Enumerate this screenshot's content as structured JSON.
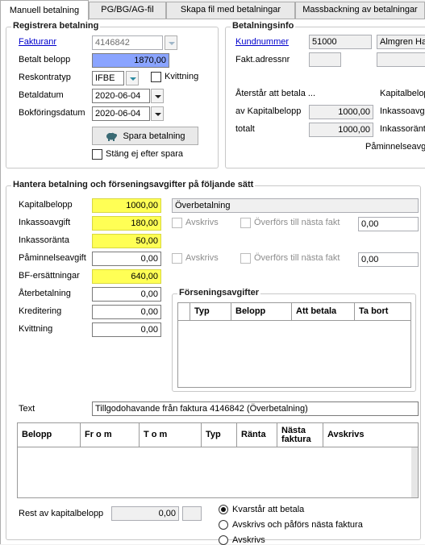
{
  "tabs": [
    "Manuell betalning",
    "PG/BG/AG-fil",
    "Skapa fil med betalningar",
    "Massbackning av betalningar"
  ],
  "register": {
    "title": "Registrera betalning",
    "fakturanr_label": "Fakturanr",
    "fakturanr_value": "4146842",
    "betalt_label": "Betalt belopp",
    "betalt_value": "1870,00",
    "reskontra_label": "Reskontratyp",
    "reskontra_value": "IFBE",
    "kvittning_label": "Kvittning",
    "betaldatum_label": "Betaldatum",
    "betaldatum_value": "2020-06-04",
    "bokforing_label": "Bokföringsdatum",
    "bokforing_value": "2020-06-04",
    "spara_label": "Spara betalning",
    "stang_label": "Stäng ej efter spara"
  },
  "info": {
    "title": "Betalningsinfo",
    "kundnummer_label": "Kundnummer",
    "kundnummer_value": "51000",
    "kundnamn_value": "Almgren Han",
    "fakt_label": "Fakt.adressnr",
    "aterstar_label": "Återstår att betala ...",
    "av_kap_label": "av Kapitalbelopp",
    "av_kap_value": "1000,00",
    "totalt_label": "totalt",
    "totalt_value": "1000,00",
    "right_labels": [
      "Kapitalbelop",
      "Inkassoavgi",
      "Inkassoränt",
      "Påminnelseavgi"
    ]
  },
  "hantera": {
    "title": "Hantera betalning och förseningsavgifter på följande sätt",
    "rows": [
      {
        "label": "Kapitalbelopp",
        "value": "1000,00"
      },
      {
        "label": "Inkassoavgift",
        "value": "180,00"
      },
      {
        "label": "Inkassoränta",
        "value": "50,00"
      },
      {
        "label": "Påminnelseavgift",
        "value": "0,00"
      },
      {
        "label": "BF-ersättningar",
        "value": "640,00"
      },
      {
        "label": "Återbetalning",
        "value": "0,00"
      },
      {
        "label": "Kreditering",
        "value": "0,00"
      },
      {
        "label": "Kvittning",
        "value": "0,00"
      }
    ],
    "status_value": "Överbetalning",
    "avskrivs_label": "Avskrivs",
    "overfors_label": "Överförs till nästa fakt",
    "overfors_value_1": "0,00",
    "overfors_value_2": "0,00",
    "forsenings": {
      "title": "Förseningsavgifter",
      "columns": [
        "Typ",
        "Belopp",
        "Att betala",
        "Ta bort"
      ]
    },
    "text_label": "Text",
    "text_value": "Tillgodohavande från faktura 4146842 (Överbetalning)"
  },
  "main_grid": {
    "columns": [
      "Belopp",
      "Fr o m",
      "T o m",
      "Typ",
      "Ränta",
      "Nästa faktura",
      "Avskrivs"
    ]
  },
  "rest": {
    "label": "Rest av kapitalbelopp",
    "value": "0,00",
    "options": [
      "Kvarstår att betala",
      "Avskrivs och påförs nästa faktura",
      "Avskrivs"
    ]
  }
}
